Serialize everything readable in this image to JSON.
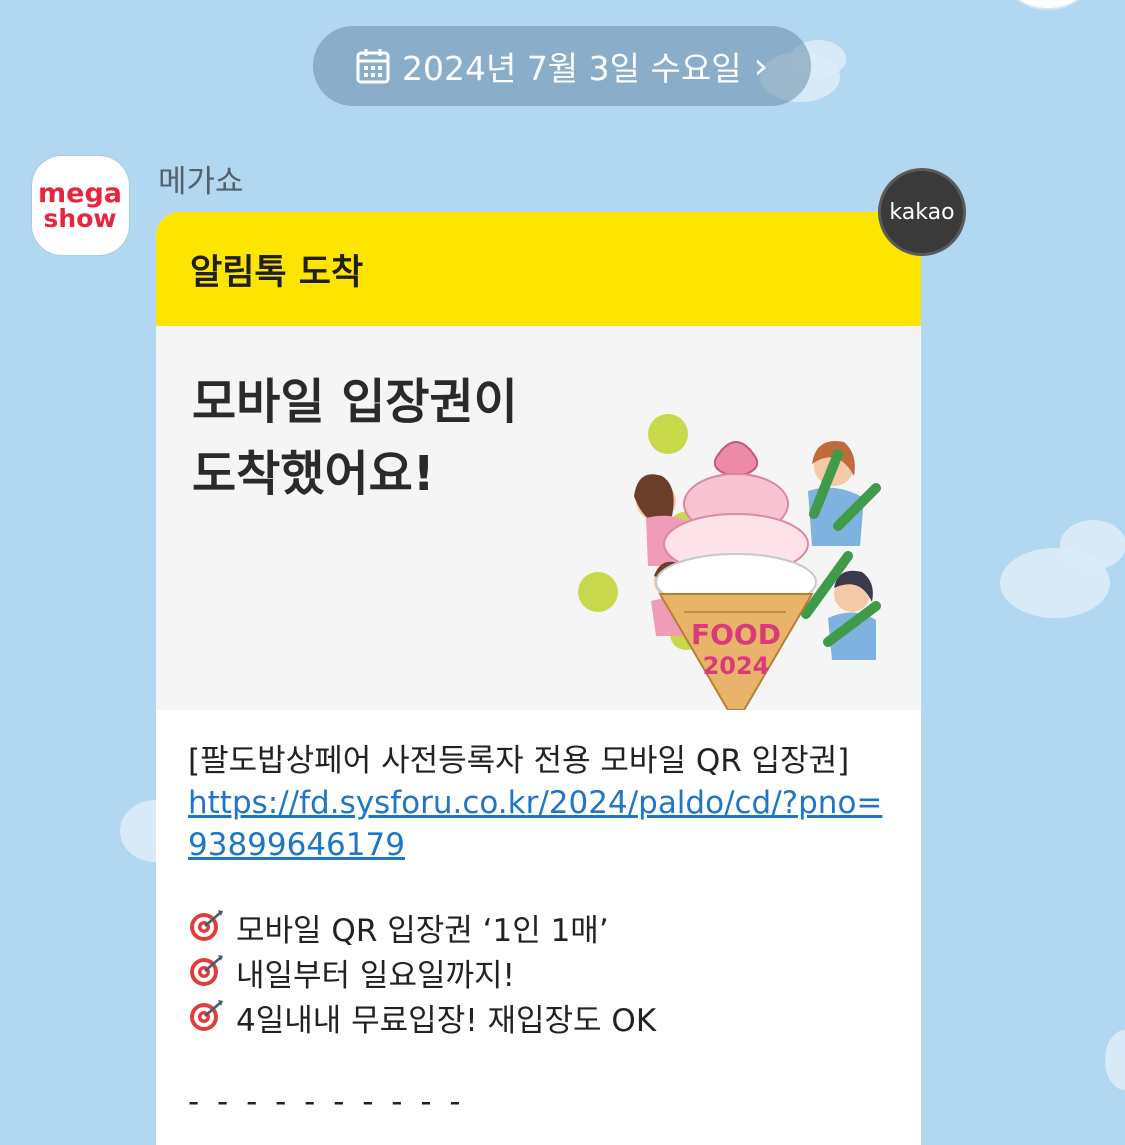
{
  "date_pill": {
    "label": "2024년 7월 3일 수요일",
    "chevron": "›"
  },
  "sender": {
    "name": "메가쇼",
    "avatar_text_top": "mega",
    "avatar_text_bottom": "show"
  },
  "badge": {
    "label": "kakao"
  },
  "bubble": {
    "header": "알림톡 도착",
    "hero_title_line1": "모바일 입장권이",
    "hero_title_line2": "도착했어요!",
    "illustration_text_line1": "FOOD",
    "illustration_text_line2": "2024",
    "intro": "[팔도밥상페어 사전등록자 전용 모바일 QR 입장권]",
    "link": "https://fd.sysforu.co.kr/2024/paldo/cd/?pno=93899646179",
    "bullets": [
      "모바일 QR 입장권 ‘1인 1매’",
      "내일부터 일요일까지!",
      "4일내내 무료입장! 재입장도 OK"
    ],
    "divider": "- - - - - - - - - -"
  },
  "colors": {
    "background": "#b2d7f1",
    "header_yellow": "#fee500",
    "link": "#1f76c7",
    "brand_red": "#e8253f"
  },
  "icons": {
    "date": "calendar-icon",
    "bullet": "dart-target-icon",
    "more": "chevron-right-icon"
  }
}
